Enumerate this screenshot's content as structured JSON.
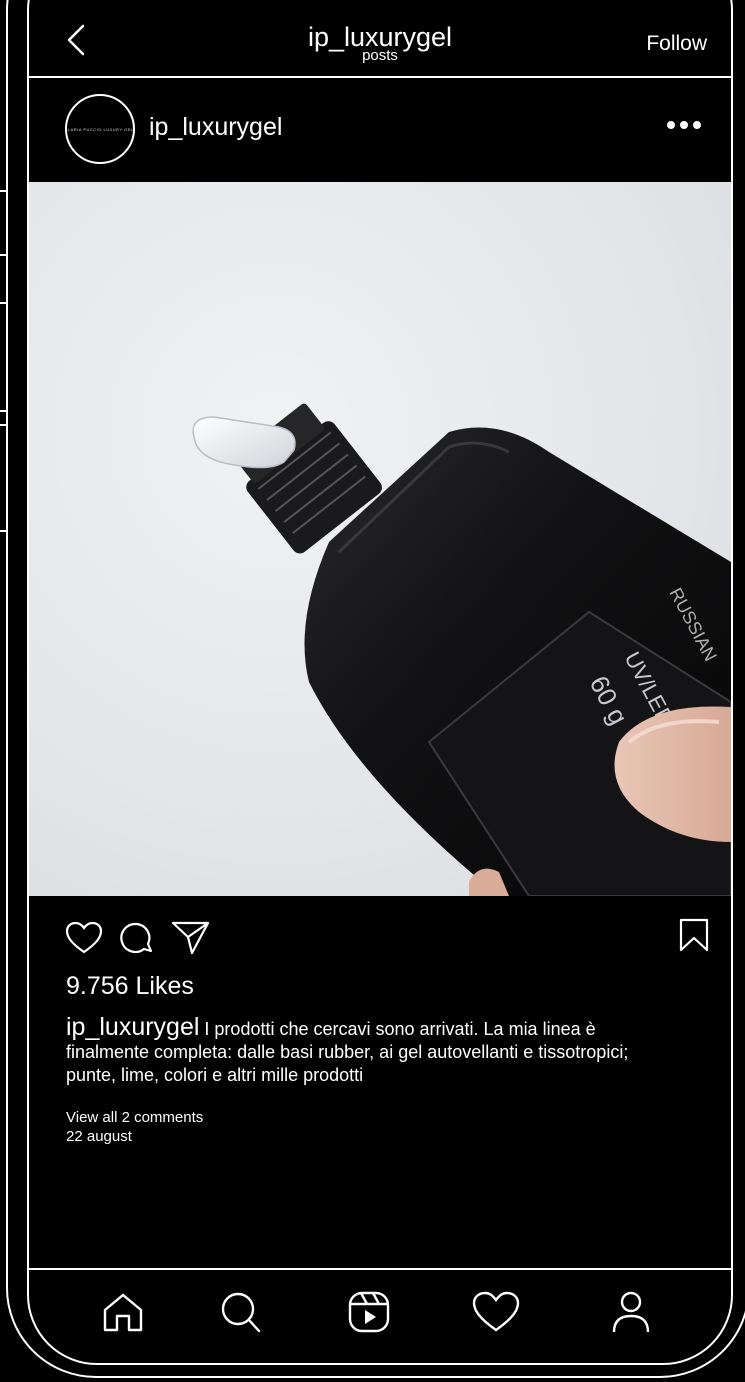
{
  "header": {
    "title": "ip_luxurygel",
    "subtitle": "posts",
    "follow_label": "Follow"
  },
  "post": {
    "username": "ip_luxurygel",
    "avatar_text": "ILARIA PUCCIO LUXURY GEL",
    "likes": "9.756 Likes",
    "caption_user": "ip_luxurygel",
    "caption_text": " I prodotti che cercavi sono arrivati. La mia linea è finalmente completa: dalle basi rubber, ai gel autovellanti e tissotropici; punte, lime, colori e altri mille prodotti",
    "view_comments": "View all 2 comments",
    "date": "22 august",
    "tube_label_1": "60 g",
    "tube_label_2": "UV/LED",
    "tube_label_3": "RUSSIAN"
  },
  "icons": {
    "back": "chevron-left-icon",
    "more": "more-horizontal-icon",
    "like": "heart-icon",
    "comment": "comment-bubble-icon",
    "share": "paper-plane-icon",
    "save": "bookmark-icon",
    "nav": [
      "home-icon",
      "search-icon",
      "reels-icon",
      "heart-icon",
      "profile-icon"
    ]
  },
  "colors": {
    "background": "#000000",
    "foreground": "#ffffff",
    "photo_background": "#e6e8eb"
  }
}
